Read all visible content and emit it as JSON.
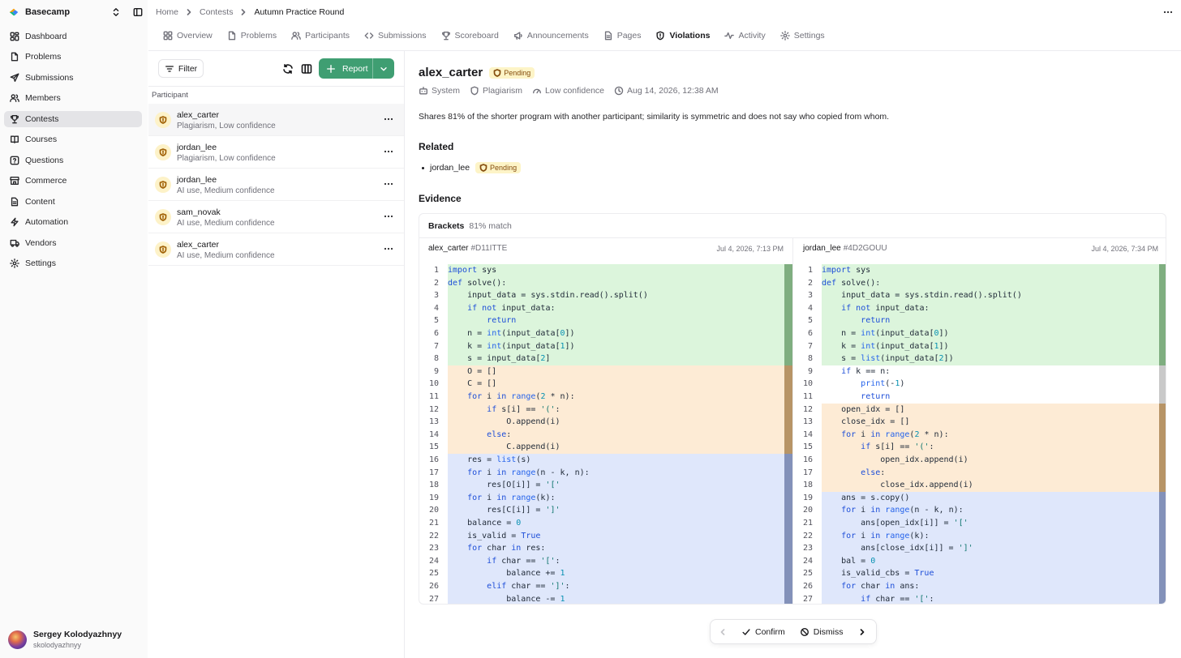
{
  "app": {
    "name": "Basecamp"
  },
  "sidebar": {
    "items": [
      {
        "label": "Dashboard",
        "icon": "dashboard-icon"
      },
      {
        "label": "Problems",
        "icon": "file-icon"
      },
      {
        "label": "Submissions",
        "icon": "send-icon"
      },
      {
        "label": "Members",
        "icon": "users-icon"
      },
      {
        "label": "Contests",
        "icon": "trophy-icon",
        "active": true
      },
      {
        "label": "Courses",
        "icon": "book-icon"
      },
      {
        "label": "Questions",
        "icon": "help-icon"
      },
      {
        "label": "Commerce",
        "icon": "store-icon"
      },
      {
        "label": "Content",
        "icon": "document-icon"
      },
      {
        "label": "Automation",
        "icon": "zap-icon"
      },
      {
        "label": "Vendors",
        "icon": "truck-icon"
      },
      {
        "label": "Settings",
        "icon": "gear-icon"
      }
    ],
    "user": {
      "name": "Sergey Kolodyazhnyy",
      "handle": "skolodyazhnyy"
    }
  },
  "breadcrumb": [
    "Home",
    "Contests",
    "Autumn Practice Round"
  ],
  "tabs": [
    {
      "label": "Overview",
      "icon": "grid-icon"
    },
    {
      "label": "Problems",
      "icon": "file-icon"
    },
    {
      "label": "Participants",
      "icon": "users-icon"
    },
    {
      "label": "Submissions",
      "icon": "code-icon"
    },
    {
      "label": "Scoreboard",
      "icon": "trophy-icon"
    },
    {
      "label": "Announcements",
      "icon": "megaphone-icon"
    },
    {
      "label": "Pages",
      "icon": "file-icon"
    },
    {
      "label": "Violations",
      "icon": "shield-icon",
      "active": true
    },
    {
      "label": "Activity",
      "icon": "activity-icon"
    },
    {
      "label": "Settings",
      "icon": "gear-icon"
    }
  ],
  "list": {
    "filter_label": "Filter",
    "report_label": "Report",
    "column_header": "Participant",
    "rows": [
      {
        "name": "alex_carter",
        "desc": "Plagiarism, Low confidence",
        "selected": true
      },
      {
        "name": "jordan_lee",
        "desc": "Plagiarism, Low confidence"
      },
      {
        "name": "jordan_lee",
        "desc": "AI use, Medium confidence"
      },
      {
        "name": "sam_novak",
        "desc": "AI use, Medium confidence"
      },
      {
        "name": "alex_carter",
        "desc": "AI use, Medium confidence"
      }
    ]
  },
  "detail": {
    "title": "alex_carter",
    "status": "Pending",
    "meta": {
      "source": "System",
      "type": "Plagiarism",
      "confidence": "Low confidence",
      "date": "Aug 14, 2026, 12:38 AM"
    },
    "description": "Shares 81% of the shorter program with another participant; similarity is symmetric and does not say who copied from whom.",
    "related_heading": "Related",
    "related": [
      {
        "name": "jordan_lee",
        "status": "Pending"
      }
    ],
    "evidence_heading": "Evidence",
    "evidence": {
      "problem": "Brackets",
      "match": "81% match",
      "left": {
        "user": "alex_carter",
        "id": "#D11ITTE",
        "date": "Jul 4, 2026, 7:13 PM"
      },
      "right": {
        "user": "jordan_lee",
        "id": "#4D2GOUU",
        "date": "Jul 4, 2026, 7:34 PM"
      },
      "left_lines": [
        "import sys",
        "def solve():",
        "    input_data = sys.stdin.read().split()",
        "    if not input_data:",
        "        return",
        "    n = int(input_data[0])",
        "    k = int(input_data[1])",
        "    s = input_data[2]",
        "    O = []",
        "    C = []",
        "    for i in range(2 * n):",
        "        if s[i] == '(':",
        "            O.append(i)",
        "        else:",
        "            C.append(i)",
        "    res = list(s)",
        "    for i in range(n - k, n):",
        "        res[O[i]] = '['",
        "    for i in range(k):",
        "        res[C[i]] = ']'",
        "    balance = 0",
        "    is_valid = True",
        "    for char in res:",
        "        if char == '[':",
        "            balance += 1",
        "        elif char == ']':",
        "            balance -= 1"
      ],
      "right_lines": [
        "import sys",
        "def solve():",
        "    input_data = sys.stdin.read().split()",
        "    if not input_data:",
        "        return",
        "    n = int(input_data[0])",
        "    k = int(input_data[1])",
        "    s = list(input_data[2])",
        "    if k == n:",
        "        print(-1)",
        "        return",
        "    open_idx = []",
        "    close_idx = []",
        "    for i in range(2 * n):",
        "        if s[i] == '(':",
        "            open_idx.append(i)",
        "        else:",
        "            close_idx.append(i)",
        "    ans = s.copy()",
        "    for i in range(n - k, n):",
        "        ans[open_idx[i]] = '['",
        "    for i in range(k):",
        "        ans[close_idx[i]] = ']'",
        "    bal = 0",
        "    is_valid_cbs = True",
        "    for char in ans:",
        "        if char == '[':"
      ],
      "left_highlight": [
        "green",
        "green",
        "green",
        "green",
        "green",
        "green",
        "green",
        "green",
        "orange",
        "orange",
        "orange",
        "orange",
        "orange",
        "orange",
        "orange",
        "blue",
        "blue",
        "blue",
        "blue",
        "blue",
        "blue",
        "blue",
        "blue",
        "blue",
        "blue",
        "blue",
        "blue"
      ],
      "right_highlight": [
        "green",
        "green",
        "green",
        "green",
        "green",
        "green",
        "green",
        "green",
        "none",
        "none",
        "none",
        "orange",
        "orange",
        "orange",
        "orange",
        "orange",
        "orange",
        "orange",
        "blue",
        "blue",
        "blue",
        "blue",
        "blue",
        "blue",
        "blue",
        "blue",
        "blue"
      ],
      "colors": {
        "green": "#dcf5dc",
        "orange": "#fdebd5",
        "blue": "#dfe7fb",
        "none": "#ffffff"
      }
    }
  },
  "actions": {
    "confirm": "Confirm",
    "dismiss": "Dismiss"
  },
  "theme": {
    "accent": "#3f9e72",
    "pending_bg": "#fdf4c7"
  }
}
